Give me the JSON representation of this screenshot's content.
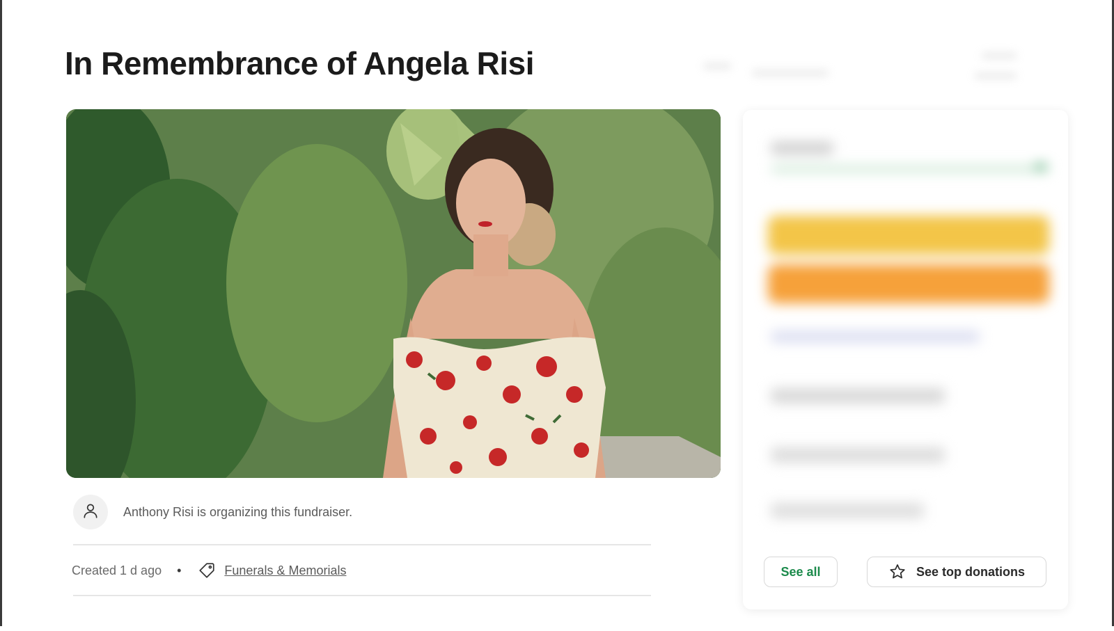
{
  "page": {
    "title": "In Remembrance of Angela Risi"
  },
  "organizer": {
    "text": "Anthony Risi is organizing this fundraiser.",
    "avatar_icon": "user-icon"
  },
  "meta": {
    "created": "Created 1 d ago",
    "separator": "•",
    "category_icon": "tag-icon",
    "category": "Funerals & Memorials"
  },
  "donations": {
    "see_all_label": "See all",
    "top_donations_label": "See top donations",
    "top_donations_icon": "star-icon",
    "accent_green": "#1b8a4b",
    "donate_yellow": "#f3c548",
    "share_orange": "#f6a13a"
  }
}
